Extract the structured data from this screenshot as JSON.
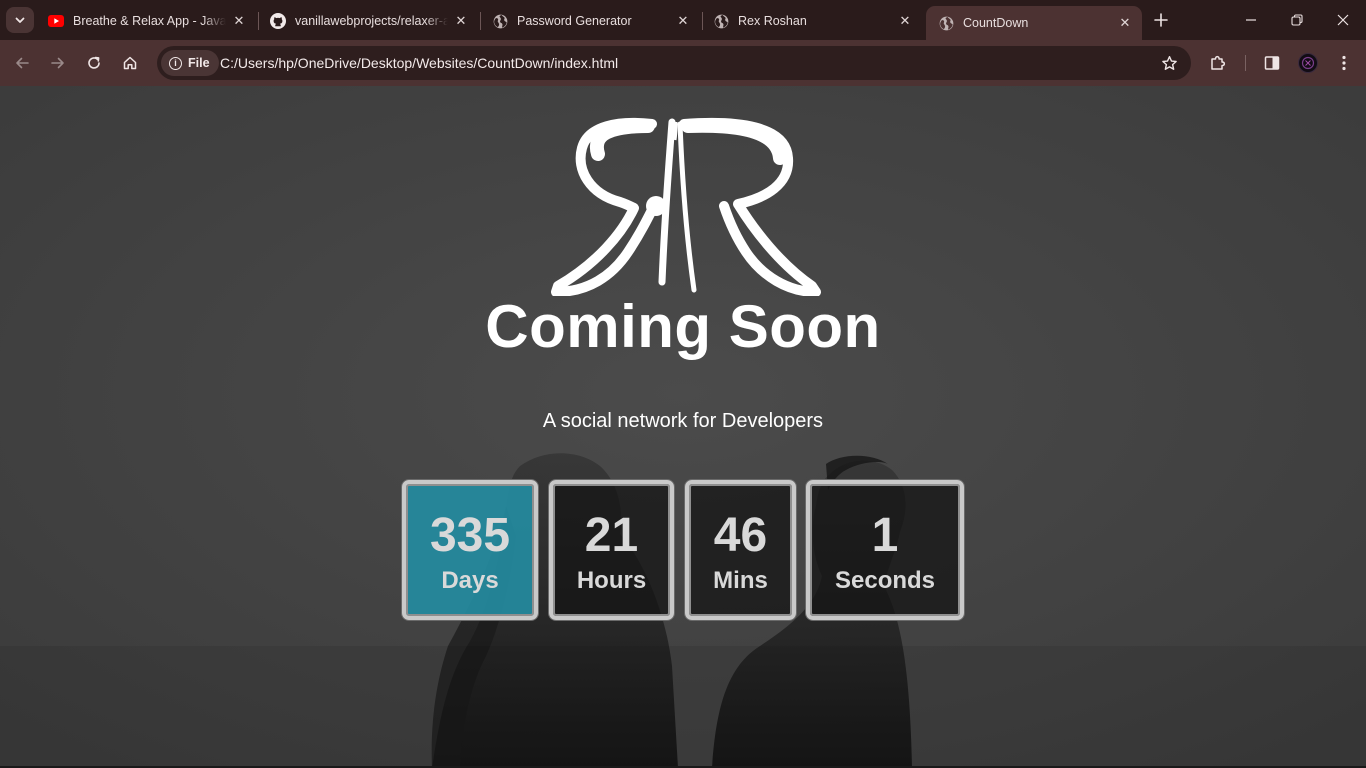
{
  "browser": {
    "tabs": [
      {
        "title": "Breathe & Relax App - JavaScript",
        "icon": "youtube-icon",
        "active": false
      },
      {
        "title": "vanillawebprojects/relaxer-app",
        "icon": "github-icon",
        "active": false
      },
      {
        "title": "Password Generator",
        "icon": "globe-icon",
        "active": false
      },
      {
        "title": "Rex Roshan",
        "icon": "globe-icon",
        "active": false
      },
      {
        "title": "CountDown",
        "icon": "globe-icon",
        "active": true
      }
    ],
    "address_bar": {
      "chip_label": "File",
      "url": "C:/Users/hp/OneDrive/Desktop/Websites/CountDown/index.html"
    },
    "colors": {
      "tabbar_bg": "#2a1b1b",
      "toolbar_bg": "#4c3232",
      "omnibox_bg": "#2e1e1e"
    }
  },
  "page": {
    "headline": "Coming Soon",
    "tagline": "A social network for Developers",
    "countdown": [
      {
        "value": "335",
        "label": "Days",
        "highlight": true
      },
      {
        "value": "21",
        "label": "Hours",
        "highlight": false
      },
      {
        "value": "46",
        "label": "Mins",
        "highlight": false
      },
      {
        "value": "1",
        "label": "Seconds",
        "highlight": false
      }
    ],
    "colors": {
      "accent": "#248ba0",
      "text": "#ffffff",
      "box_border": "#c9c9c9"
    }
  }
}
